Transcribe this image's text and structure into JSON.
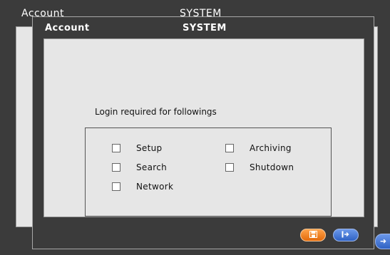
{
  "background_window": {
    "title_left": "Account",
    "title_center": "SYSTEM"
  },
  "dialog": {
    "title_left": "Account",
    "title_center": "SYSTEM",
    "prompt": "Login required for followings",
    "options": [
      {
        "label": "Setup",
        "checked": false
      },
      {
        "label": "Archiving",
        "checked": false
      },
      {
        "label": "Search",
        "checked": false
      },
      {
        "label": "Shutdown",
        "checked": false
      },
      {
        "label": "Network",
        "checked": false
      }
    ],
    "buttons": {
      "save_icon": "save-icon",
      "exit_icon": "exit-icon"
    }
  },
  "colors": {
    "save_button": "#f0852b",
    "exit_button": "#3f73d6",
    "panel": "#e6e6e6",
    "frame": "#3b3b3b"
  }
}
